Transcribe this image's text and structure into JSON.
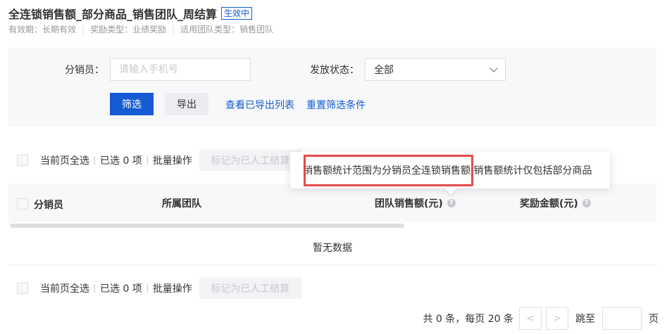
{
  "header": {
    "title": "全连锁销售额_部分商品_销售团队_周结算",
    "status_badge": "生效中",
    "meta": [
      "有效期：长期有效",
      "奖励类型：业绩奖励",
      "适用团队类型：销售团队"
    ]
  },
  "filter": {
    "distributor_label": "分销员：",
    "distributor_placeholder": "请输入手机号",
    "status_label": "发放状态：",
    "status_value": "全部",
    "filter_button": "筛选",
    "export_button": "导出",
    "view_exported_link": "查看已导出列表",
    "reset_link": "重置筛选条件"
  },
  "batch": {
    "select_page": "当前页全选",
    "selected": "已选 0 项",
    "batch_ops": "批量操作",
    "mark_button": "标记为已人工结算"
  },
  "table": {
    "columns": [
      "分销员",
      "所属团队",
      "团队销售额(元)",
      "奖励金额(元)"
    ],
    "empty_text": "暂无数据"
  },
  "tooltip": {
    "highlight_text": "销售额统计范围为分销员全连锁销售额",
    "rest_text": "销售额统计仅包括部分商品"
  },
  "pagination": {
    "summary": "共 0 条，每页 20 条",
    "prev": "<",
    "next": ">",
    "jump_label": "跳至",
    "page_unit": "页"
  },
  "colors": {
    "primary": "#155bd4",
    "highlight_border": "#e24c4c"
  }
}
